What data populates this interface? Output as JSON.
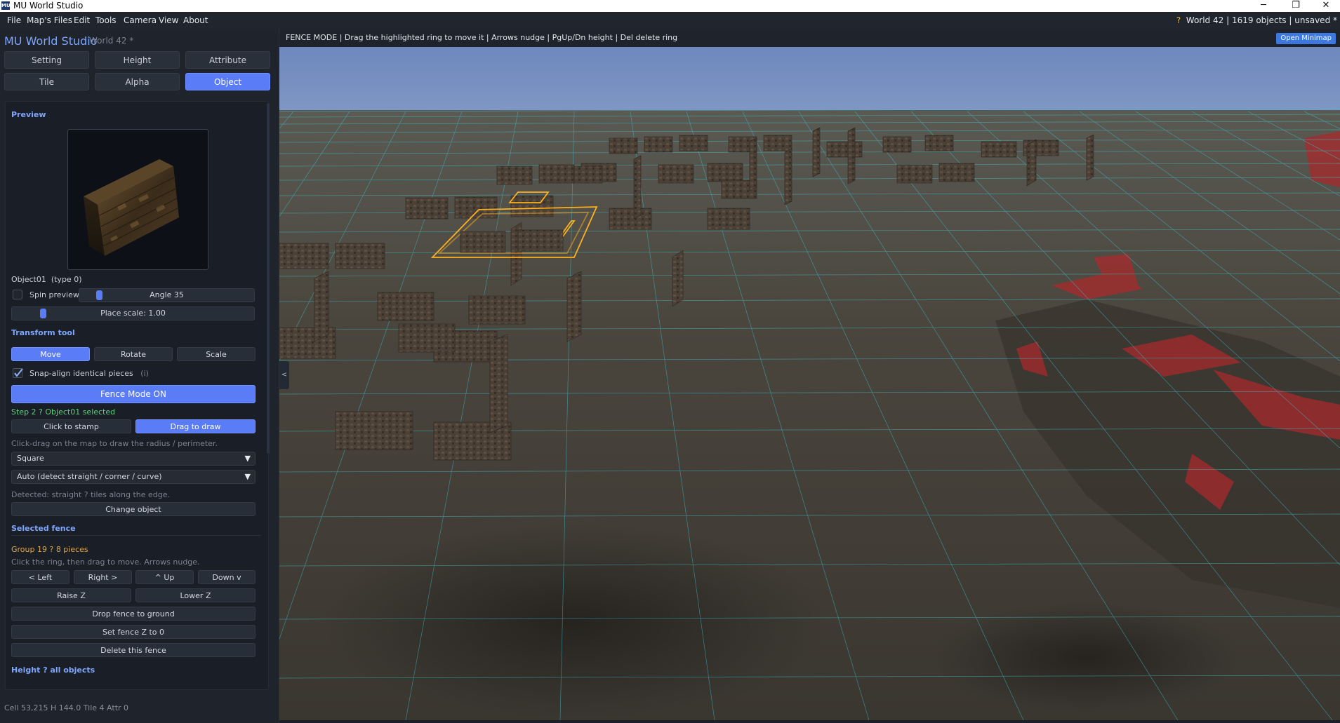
{
  "window": {
    "app_icon": "MU",
    "title": "MU World Studio",
    "controls": {
      "minimize": "─",
      "maximize": "❐",
      "close": "✕"
    }
  },
  "menu": {
    "items": [
      "File",
      "Map's Files",
      "Edit",
      "Tools",
      "Camera",
      "View",
      "About"
    ]
  },
  "status_right": {
    "warn": "?",
    "world": "World 42",
    "objects": "1619 objects",
    "unsaved": "unsaved *",
    "sep": "|"
  },
  "sidebar": {
    "app_name": "MU World Studio",
    "world_name": "World 42 *",
    "tabs": [
      {
        "label": "Setting",
        "active": false
      },
      {
        "label": "Height",
        "active": false
      },
      {
        "label": "Attribute",
        "active": false
      },
      {
        "label": "Tile",
        "active": false
      },
      {
        "label": "Alpha",
        "active": false
      },
      {
        "label": "Object",
        "active": true
      }
    ],
    "preview": {
      "heading": "Preview",
      "object_name": "Object01",
      "object_type": "(type 0)",
      "spin_label": "Spin preview",
      "spin_checked": false,
      "angle_label": "Angle 35",
      "angle_value": 35,
      "scale_label": "Place scale: 1.00",
      "scale_value": 1.0
    },
    "transform": {
      "heading": "Transform tool",
      "modes": [
        {
          "label": "Move",
          "active": true
        },
        {
          "label": "Rotate",
          "active": false
        },
        {
          "label": "Scale",
          "active": false
        }
      ],
      "snap_label": "Snap-align identical pieces",
      "snap_info": "(i)",
      "snap_checked": true,
      "fence_mode_label": "Fence Mode  ON",
      "step_text": "Step 2  ?  Object01 selected",
      "draw_modes": [
        {
          "label": "Click to stamp",
          "active": false
        },
        {
          "label": "Drag to draw",
          "active": true
        }
      ],
      "draw_hint": "Click-drag on the map to draw the radius / perimeter.",
      "shape_value": "Square",
      "detect_value": "Auto (detect straight / corner / curve)",
      "detected_text": "Detected: straight ? tiles along the edge.",
      "change_object_label": "Change object"
    },
    "selected_fence": {
      "heading": "Selected fence",
      "group_text": "Group 19  ?  8 pieces",
      "hint": "Click the ring, then drag to move. Arrows nudge.",
      "nudge": [
        "< Left",
        "Right >",
        "^ Up",
        "Down v"
      ],
      "raise_label": "Raise Z",
      "lower_label": "Lower Z",
      "drop_label": "Drop fence to ground",
      "setz_label": "Set fence Z to 0",
      "delete_label": "Delete this fence"
    },
    "height_heading": "Height ? all objects",
    "status": "Cell 53,215    H 144.0   Tile 4   Attr 0"
  },
  "viewport": {
    "hint": "FENCE MODE  |  Drag the highlighted ring to move it  |  Arrows nudge  |  PgUp/Dn height  |  Del delete ring",
    "minimap_label": "Open Minimap",
    "collapse_icon": "<",
    "colors": {
      "sky": "#6b84b8",
      "ground": "#3f3b35",
      "grid": "#3fc6d6",
      "selection": "#ffb020",
      "lava": "#b0262a"
    }
  }
}
